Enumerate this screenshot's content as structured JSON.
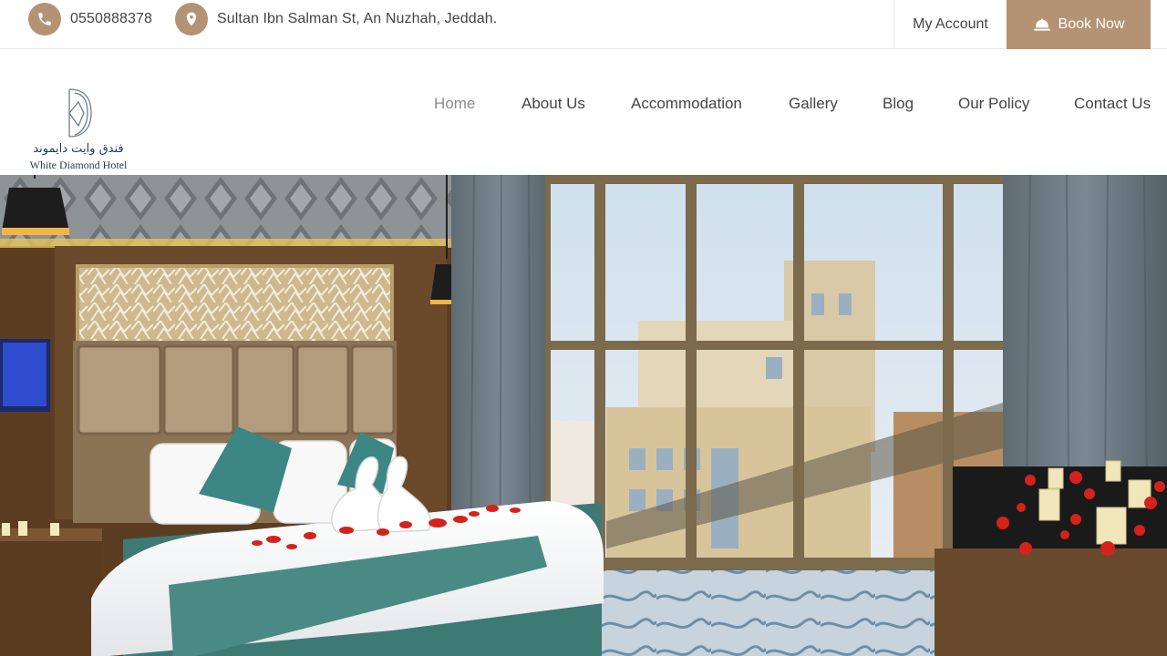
{
  "topbar": {
    "phone": "0550888378",
    "address": "Sultan Ibn Salman St, An Nuzhah, Jeddah.",
    "account_label": "My Account",
    "book_label": "Book Now"
  },
  "brand": {
    "name_ar": "فندق وايت دايموند",
    "name_en": "White Diamond Hotel"
  },
  "nav": {
    "items": [
      {
        "label": "Home",
        "active": true
      },
      {
        "label": "About Us"
      },
      {
        "label": "Accommodation"
      },
      {
        "label": "Gallery"
      },
      {
        "label": "Blog"
      },
      {
        "label": "Our Policy"
      },
      {
        "label": "Contact Us"
      }
    ]
  },
  "theme": {
    "accent": "#b39373",
    "text": "#444444",
    "nav_active": "#8a8a8a",
    "logo": "#1f3a5c"
  },
  "icons": {
    "phone": "phone-icon",
    "location": "location-pin-icon",
    "book": "bell-icon"
  }
}
